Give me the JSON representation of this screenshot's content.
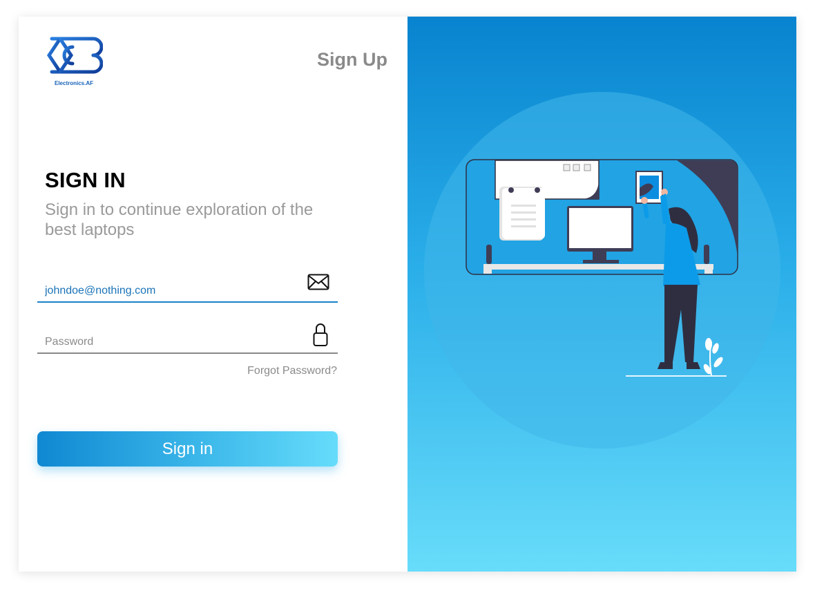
{
  "brand": {
    "name": "Electronics.AF"
  },
  "header": {
    "signup_label": "Sign Up"
  },
  "form": {
    "title": "SIGN IN",
    "subtitle": "Sign in to continue exploration of the best laptops",
    "email_value": "johndoe@nothing.com",
    "password_placeholder": "Password",
    "forgot_label": "Forgot Password?",
    "submit_label": "Sign in"
  },
  "icons": {
    "email": "envelope-icon",
    "password": "lock-icon"
  },
  "colors": {
    "accent": "#1a82c8",
    "gradient_start": "#0883cf",
    "gradient_end": "#68dcfa"
  }
}
